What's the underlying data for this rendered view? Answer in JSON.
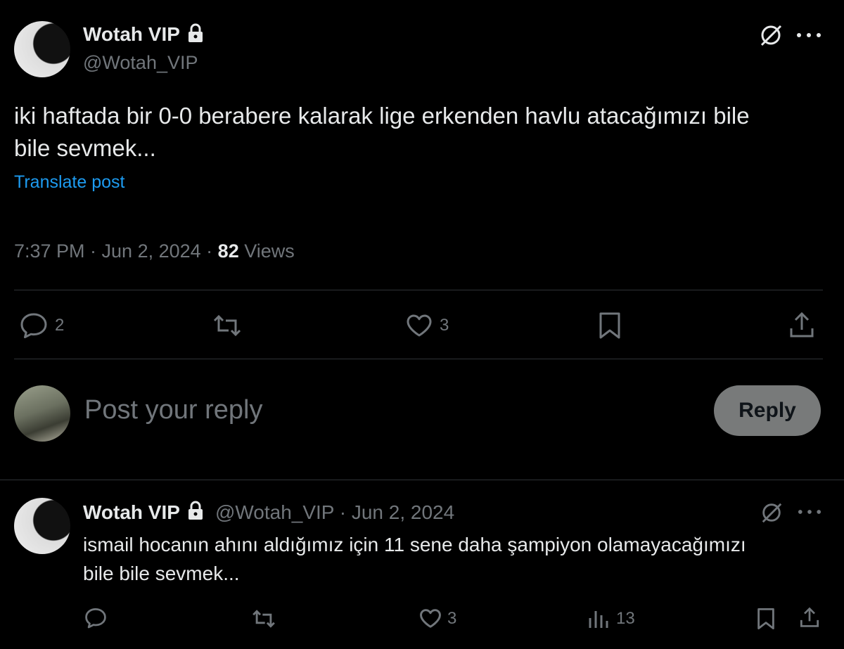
{
  "main_post": {
    "display_name": "Wotah VIP",
    "handle": "@Wotah_VIP",
    "text_line1": "iki haftada bir 0-0 berabere kalarak lige erkenden havlu atacağımızı bile",
    "text_line2": "bile sevmek...",
    "translate": "Translate post",
    "time": "7:37 PM · Jun 2, 2024 · ",
    "views_count": "82",
    "views_label": " Views",
    "actions": {
      "replies": "2",
      "reposts": "",
      "likes": "3"
    }
  },
  "composer": {
    "placeholder": "Post your reply",
    "button_label": "Reply"
  },
  "reply_post": {
    "display_name": "Wotah VIP",
    "meta": "@Wotah_VIP · Jun 2, 2024",
    "text_line1": "ismail hocanın ahını aldığımız için 11 sene daha şampiyon olamayacağımızı",
    "text_line2": "bile bile sevmek...",
    "actions": {
      "likes": "3",
      "views": "13"
    }
  },
  "colors": {
    "background": "#000000",
    "text": "#e7e9ea",
    "muted": "#71767b",
    "link": "#1d9bf0",
    "divider": "#2f3336"
  }
}
